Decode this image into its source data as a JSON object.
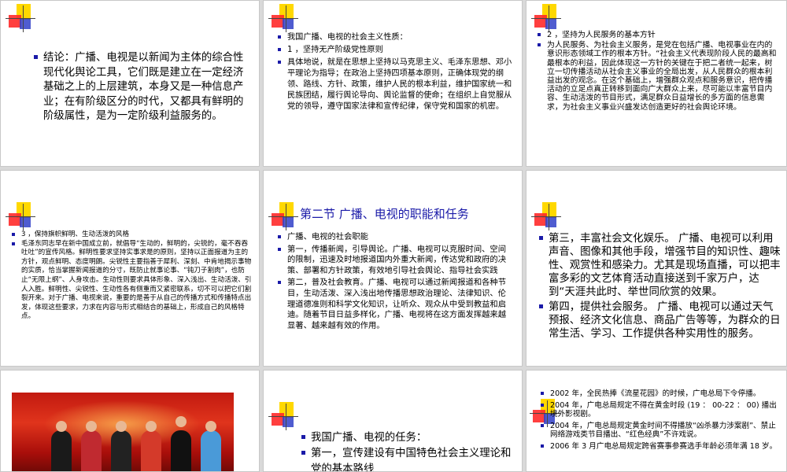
{
  "slides": {
    "s1": {
      "items": [
        "结论：广播、电视是以新闻为主体的综合性现代化舆论工具，它们既是建立在一定经济基础之上的上层建筑，本身又是一种信息产业；在有阶级区分的时代，又都具有鲜明的阶级属性，是为一定阶级利益服务的。"
      ]
    },
    "s2": {
      "items": [
        "我国广播、电视的社会主义性质：",
        "1 ，坚持无产阶级党性原则",
        "具体地说，就是在思想上坚持以马克思主义、毛泽东思想、邓小平理论为指导；在政治上坚持四项基本原则，正确体现党的纲领、路线、方针、政策，维护人民的根本利益，维护国家统一和民族团结，履行舆论导向、舆论监督的使命；在组织上自觉服从党的领导，遵守国家法律和宣传纪律，保守党和国家的机密。"
      ]
    },
    "s3": {
      "items": [
        "2 ，坚持为人民服务的基本方针",
        "为人民服务、为社会主义服务，是党在包括广播、电视事业在内的意识形态领域工作的根本方针。“社会主义代表现阶段人民的最高和最根本的利益，因此体现这一方针的关键在于把二者统一起来，树立一切传播活动从社会主义事业的全局出发，从人民群众的根本利益出发的观念。在这个基础上，增强群众观点和服务意识，把传播活动的立足点真正转移到面向广大群众上来，尽可能以丰富节目内容、生动活泼的节目形式，满足群众日益增长的多方面的信息需求，为社会主义事业兴盛发达创造更好的社会舆论环境。"
      ]
    },
    "s4": {
      "items": [
        "3 ，保持旗帜鲜明、生动活泼的风格",
        "毛泽东同志早在新中国成立前，就倡导“生动的，鲜明的，尖锐的，毫不吞吞吐吐”的宣传风格。鲜明性要求坚持实事求是的原则，坚持以正面报道为主的方针，观点鲜明、态度明朗。尖锐性主要指善于犀利、深刻、中肯地揭示事物的实质，恰当掌握新闻报道的分寸，既防止就事论事、“钝刀子割肉”，也防止“无限上纲”、人身攻击。生动性则要求具体形象、深入浅出、生动活泼、引人入胜。鲜明性、尖锐性、生动性各有侧重而又紧密联系，切不可以把它们割裂开来。对于广播、电视来说，重要的是善于从自己的传播方式和传播特点出发，体现这些要求，力求在内容与形式相结合的基础上，形成自己的风格特点。"
      ]
    },
    "s5": {
      "title": "第二节 广播、电视的职能和任务",
      "items": [
        "广播、电视的社会职能",
        "第一，传播新闻，引导舆论。广播、电视可以克服时间、空间的限制，迅速及时地报道国内外重大新闻，传达党和政府的决策、部署和方针政策，有效地引导社会舆论、指导社会实践",
        "第二，普及社会教育。广播、电视可以通过新闻报道和各种节目，生动活泼、深入浅出地传播思想政治理论、法律知识、伦理道德准则和科学文化知识，让听众、观众从中受到教益和启迪。随着节目日益多样化，广播、电视将在这方面发挥越来越显著、越来越有效的作用。"
      ]
    },
    "s6": {
      "items": [
        "第三，丰富社会文化娱乐。 广播、电视可以利用声音、图像和其他手段，增强节目的知识性、趣味性、观赏性和感染力。尤其是现场直播，可以把丰富多彩的文艺体育活动直接送到千家万户，达到“天涯共此时、举世同欣赏的效果。",
        "第四，提供社会服务。 广播、电视可以通过天气预报、经济文化信息、商品广告等等，为群众的日常生活、学习、工作提供各种实用性的服务。"
      ]
    },
    "s8": {
      "items": [
        "我国广播、电视的任务：",
        "第一，宣传建设有中国特色社会主义理论和党的基本路线"
      ]
    },
    "s9": {
      "items": [
        "2002 年，全民热捧《流星花园》的时候，广电总局下令停播。",
        "2004 年，广电总局规定不得在黄金时段 (19 ： 00-22 ： 00) 播出境外影视剧。",
        "2004 年，广电总局规定黄金时间不得播放“凶杀暴力涉案剧”、禁止网络游戏类节目播出、“红色经典”不许戏说。",
        "2006 年 3 月广电总局规定跨省赛事参赛选手年龄必须年满 18 岁。"
      ]
    }
  },
  "colors": {
    "bullet": "#1a1aa8",
    "title": "#1a1aa8",
    "logo_yellow": "#ffd800",
    "logo_red": "#ff2a2a",
    "logo_blue": "#3040c8"
  }
}
